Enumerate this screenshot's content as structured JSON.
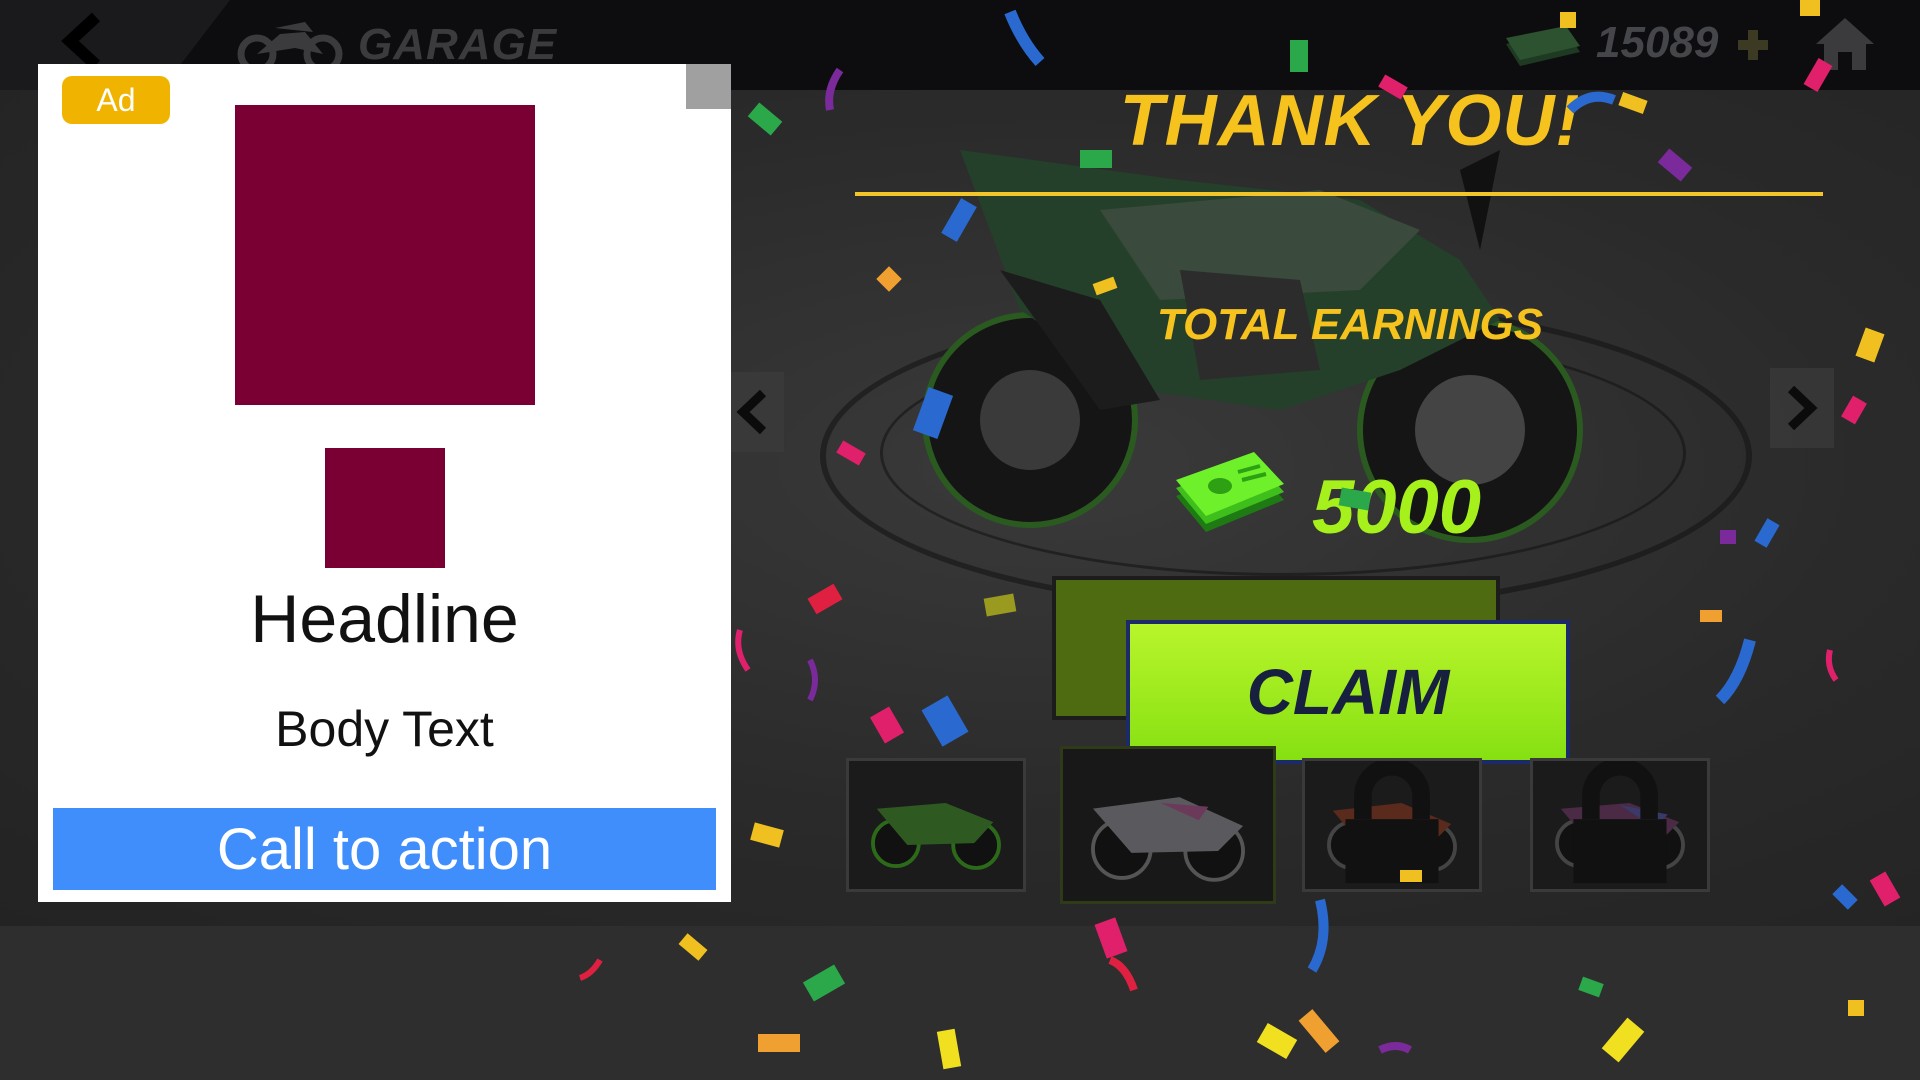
{
  "header": {
    "title": "GARAGE",
    "coins": "15089",
    "icons": {
      "back": "chevron-left-icon",
      "garage": "motorbike-icon",
      "cash": "cash-stack-icon",
      "add": "plus-icon",
      "home": "home-icon"
    }
  },
  "reward_panel": {
    "title": "THANK YOU!",
    "earnings_label": "TOTAL EARNINGS",
    "earnings_value": "5000",
    "claim_label": "CLAIM"
  },
  "bike_thumbnails": [
    {
      "name": "green bike",
      "locked": false,
      "selected": false
    },
    {
      "name": "white bike",
      "locked": false,
      "selected": true
    },
    {
      "name": "red bike",
      "locked": true,
      "selected": false
    },
    {
      "name": "pink bike",
      "locked": true,
      "selected": false
    }
  ],
  "ad": {
    "badge": "Ad",
    "headline": "Headline",
    "body": "Body Text",
    "cta": "Call to action"
  },
  "colors": {
    "accent_yellow": "#f6c21d",
    "claim_green": "#a6f01c",
    "ad_media": "#7a0033",
    "cta_blue": "#3f8efc",
    "ad_badge": "#f0b400"
  }
}
